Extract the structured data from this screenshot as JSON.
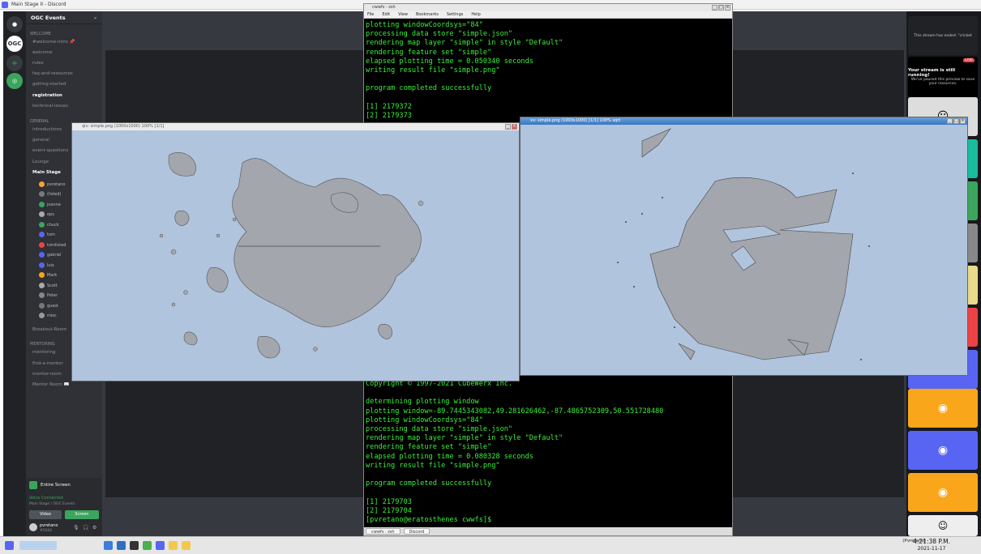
{
  "app": {
    "window_title": "Main Stage II - Discord"
  },
  "server": {
    "name": "OGC Events",
    "categories": [
      "WELCOME",
      "GENERAL",
      "MENTORING"
    ],
    "welcome_channels": [
      "#welcome-intro 📌",
      "welcome",
      "rules",
      "faq-and-resources",
      "getting-started",
      "registration",
      "technical-issues"
    ],
    "general_channels": [
      "introductions",
      "general",
      "event-questions",
      "Lounge",
      "Main Stage"
    ],
    "main_stage_users": [
      "pvretano",
      "(listed)",
      "joanne",
      "ops",
      "chuck",
      "tom",
      "tomlisted",
      "gabriel",
      "luis",
      "Mark",
      "Scott",
      "Peter",
      "guest",
      "misc"
    ],
    "more_channels": [
      "Breakout-Room",
      "mentoring",
      "find-a-mentor",
      "mentor-room",
      "Mentor Room 📖"
    ],
    "stream_panel": {
      "title": "Entire Screen",
      "voice_status": "Voice Connected",
      "voice_sub": "Main Stage / OGC Events",
      "video_label": "Video",
      "screen_label": "Screen"
    },
    "user": {
      "name": "pvretano",
      "tag": "#5042"
    }
  },
  "participants": {
    "stream_ended_text": "This stream has ended. \"cricket",
    "live_badge": "LIVE",
    "live_title": "Your stream is still running!",
    "live_sub": "We've paused this preview to save your resources."
  },
  "terminal": {
    "title": "cwwfs - zsh",
    "menu": [
      "File",
      "Edit",
      "View",
      "Bookmarks",
      "Settings",
      "Help"
    ],
    "top_lines": [
      "plotting windowCoordsys=\"84\"",
      "processing data store \"simple.json\"",
      "rendering map layer \"simple\" in style \"Default\"",
      "rendering feature set \"simple\"",
      "elapsed plotting time = 0.050340 seconds",
      "writing result file \"simple.png\"",
      "",
      "program completed successfully",
      "",
      "[1] 2179372",
      "[2] 2179373"
    ],
    "bottom_lines": [
      "Copyright © 1997-2021 CubeWerx Inc.",
      "",
      "determining plotting window",
      "plotting window=-89.7445343082,49.281626462,-87.4865752309,50.551728480",
      "plotting windowCoordsys=\"84\"",
      "processing data store \"simple.json\"",
      "rendering map layer \"simple\" in style \"Default\"",
      "rendering feature set \"simple\"",
      "elapsed plotting time = 0.080328 seconds",
      "writing result file \"simple.png\"",
      "",
      "program completed successfully",
      "",
      "[1] 2179703",
      "[2] 2179704",
      "[pvretano@eratosthenes cwwfs]$ "
    ],
    "tabs": [
      "cwwfs : zsh",
      "Discord"
    ]
  },
  "map_left": {
    "title": "qiv: simple.png (1000x1000) 100% [1/1]"
  },
  "map_right": {
    "title": "xv: simple.png (1000x1000) [1/1] 100% sqrt"
  },
  "taskbar": {
    "time": "4:21:38 P.M.",
    "date": "2021-11-17",
    "user": "(Pvretano)"
  },
  "colors": {
    "map_bg": "#b0c4de",
    "land": "#a3a6ac",
    "term_text": "#3cf03c",
    "discord_blurple": "#5865f2"
  }
}
